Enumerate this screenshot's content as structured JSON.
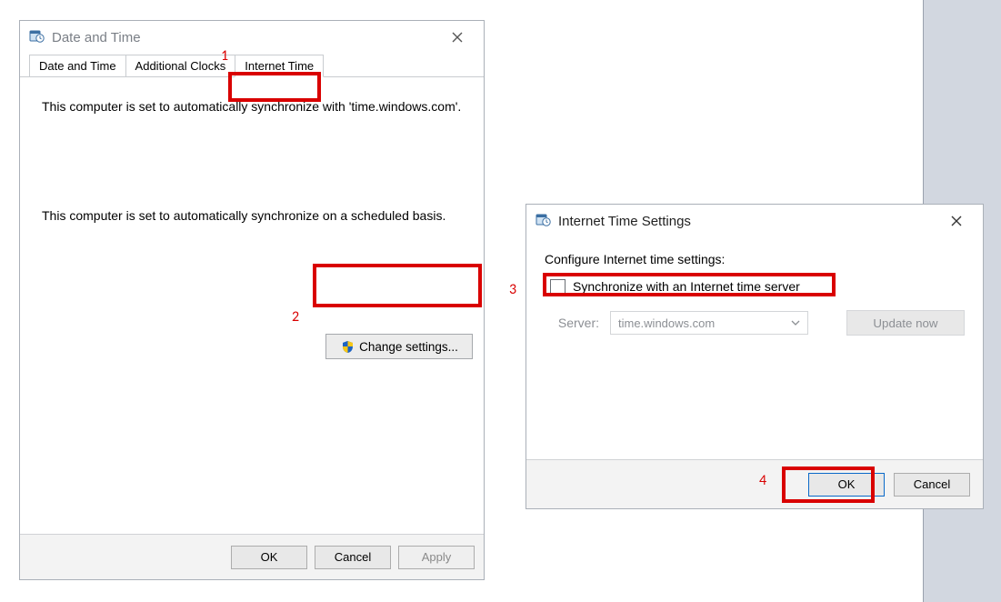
{
  "dialog1": {
    "title": "Date and Time",
    "tabs": {
      "date_time": "Date and Time",
      "additional_clocks": "Additional Clocks",
      "internet_time": "Internet Time"
    },
    "content": {
      "sync_line": "This computer is set to automatically synchronize with 'time.windows.com'.",
      "scheduled_line": "This computer is set to automatically synchronize on a scheduled basis."
    },
    "change_settings": "Change settings...",
    "buttons": {
      "ok": "OK",
      "cancel": "Cancel",
      "apply": "Apply"
    }
  },
  "dialog2": {
    "title": "Internet Time Settings",
    "configure_label": "Configure Internet time settings:",
    "sync_cb_label": "Synchronize with an Internet time server",
    "server_label": "Server:",
    "server_value": "time.windows.com",
    "update_now": "Update now",
    "buttons": {
      "ok": "OK",
      "cancel": "Cancel"
    }
  },
  "annotations": {
    "n1": "1",
    "n2": "2",
    "n3": "3",
    "n4": "4"
  }
}
